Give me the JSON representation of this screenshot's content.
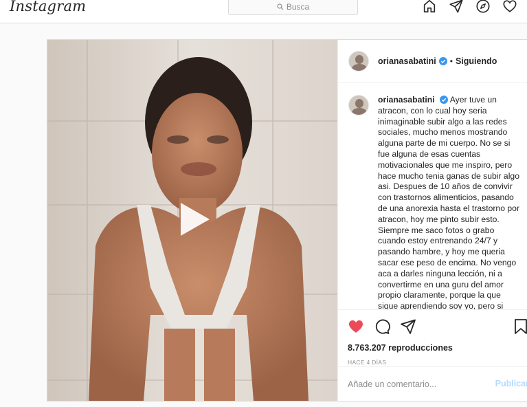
{
  "app": {
    "logo": "Instagram",
    "search_placeholder": "Busca",
    "nav_icons": [
      "home-icon",
      "direct-icon",
      "explore-icon",
      "activity-icon"
    ]
  },
  "post": {
    "username": "orianasabatini",
    "verified": true,
    "follow_separator": "•",
    "follow_status": "Siguiendo",
    "caption": "Ayer tuve un atracon, con lo cual hoy seria inimaginable subir algo a las redes sociales, mucho menos mostrando alguna parte de mi cuerpo. No se si fue alguna de esas cuentas motivacionales que me inspiro, pero hace mucho tenia ganas de subir algo asi. Despues de 10 años de convivir con trastornos alimenticios, pasando de una anorexia hasta el trastorno por atracon, hoy me pinto subir esto. Siempre me saco fotos o grabo cuando estoy entrenando 24/7 y pasando hambre, y hoy me queria sacar ese peso de encima. No vengo aca a darles ninguna lección, ni a convertirme en una guru del amor propio claramente, porque la que sigue aprendiendo soy yo, pero si",
    "liked": true,
    "views": "8.763.207 reproducciones",
    "date": "HACE 4 DÍAS",
    "comment_placeholder": "Añade un comentario...",
    "publish_label": "Publicar"
  },
  "colors": {
    "like": "#ed4956",
    "verified": "#3897f0",
    "publish_disabled": "#b3dbff"
  }
}
